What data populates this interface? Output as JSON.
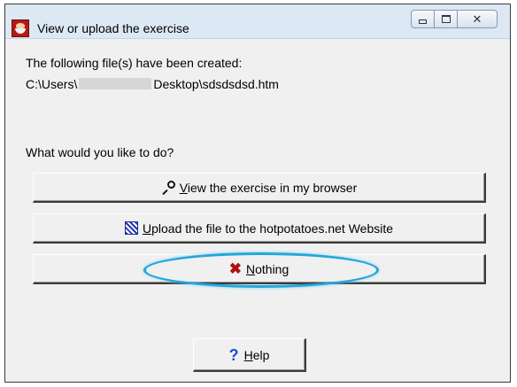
{
  "window": {
    "title": "View or upload the exercise"
  },
  "message": {
    "created_label": "The following file(s) have been created:",
    "path_prefix": "C:\\Users\\",
    "path_suffix": "Desktop\\sdsdsdsd.htm",
    "question": "What would you like to do?"
  },
  "buttons": {
    "view": {
      "mnemonic": "V",
      "rest": "iew the exercise in my browser",
      "icon": "magnifier-icon"
    },
    "upload": {
      "mnemonic": "U",
      "rest": "pload the file to the hotpotatoes.net Website",
      "icon": "upload-icon"
    },
    "nothing": {
      "mnemonic": "N",
      "rest": "othing",
      "icon": "x-icon"
    },
    "help": {
      "mnemonic": "H",
      "rest": "elp",
      "icon": "question-icon"
    }
  },
  "colors": {
    "highlight_ellipse": "#23a6dc",
    "close_icon": "#b01010",
    "help_icon": "#1f4fd6"
  }
}
